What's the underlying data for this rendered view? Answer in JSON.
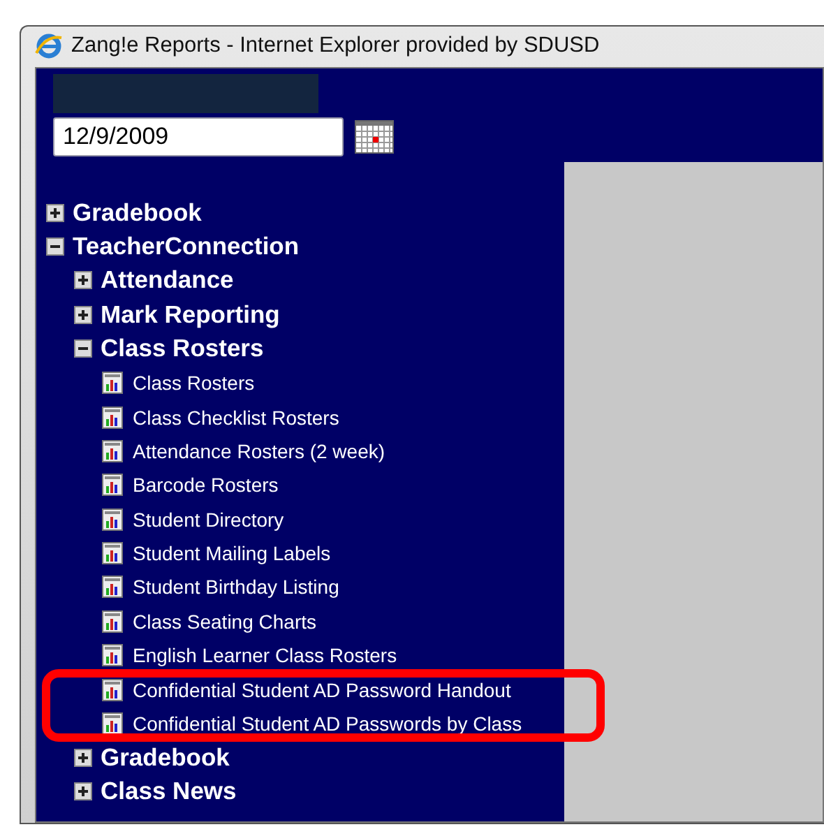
{
  "window": {
    "title": "Zang!e Reports - Internet Explorer provided by SDUSD"
  },
  "date_field": {
    "value": "12/9/2009"
  },
  "tree": [
    {
      "label": "Gradebook",
      "kind": "folder",
      "expanded": false
    },
    {
      "label": "TeacherConnection",
      "kind": "folder",
      "expanded": true,
      "children": [
        {
          "label": "Attendance",
          "kind": "folder",
          "expanded": false
        },
        {
          "label": "Mark Reporting",
          "kind": "folder",
          "expanded": false
        },
        {
          "label": "Class Rosters",
          "kind": "folder",
          "expanded": true,
          "children": [
            {
              "label": "Class Rosters",
              "kind": "report"
            },
            {
              "label": "Class Checklist Rosters",
              "kind": "report"
            },
            {
              "label": "Attendance Rosters (2 week)",
              "kind": "report"
            },
            {
              "label": "Barcode Rosters",
              "kind": "report"
            },
            {
              "label": "Student Directory",
              "kind": "report"
            },
            {
              "label": "Student Mailing Labels",
              "kind": "report"
            },
            {
              "label": "Student Birthday Listing",
              "kind": "report"
            },
            {
              "label": "Class Seating Charts",
              "kind": "report"
            },
            {
              "label": "English Learner Class Rosters",
              "kind": "report"
            },
            {
              "label": "Confidential Student AD Password Handout",
              "kind": "report"
            },
            {
              "label": "Confidential Student AD Passwords by Class",
              "kind": "report"
            }
          ]
        },
        {
          "label": "Gradebook",
          "kind": "folder",
          "expanded": false
        },
        {
          "label": "Class News",
          "kind": "folder",
          "expanded": false
        }
      ]
    }
  ]
}
